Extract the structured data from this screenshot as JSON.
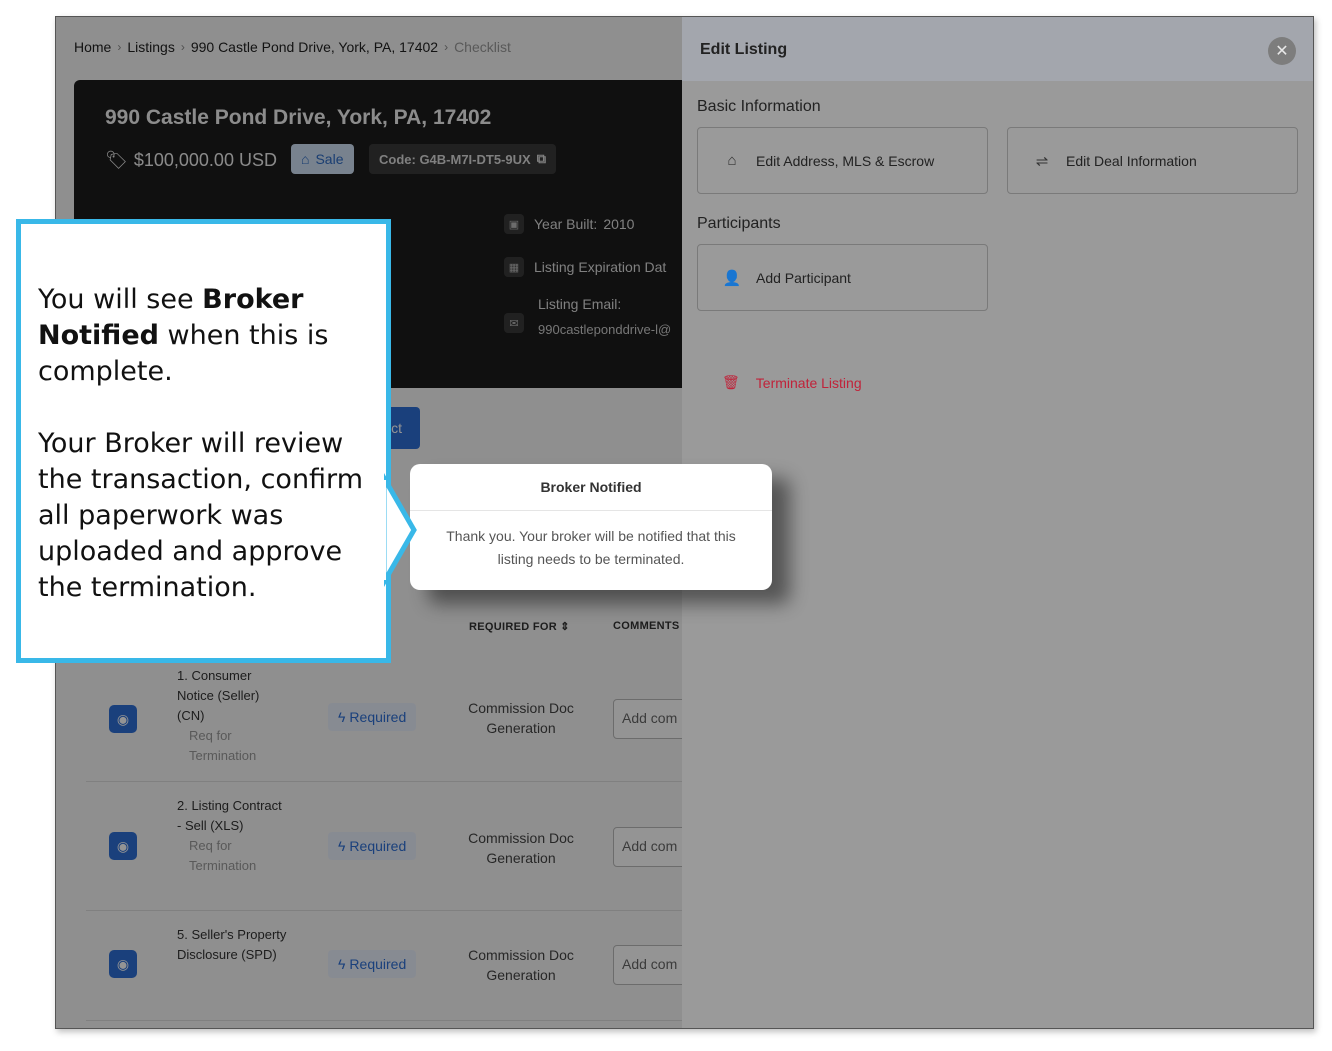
{
  "breadcrumb": {
    "home": "Home",
    "listings": "Listings",
    "address": "990 Castle Pond Drive, York, PA, 17402",
    "current": "Checklist"
  },
  "listing": {
    "address": "990 Castle Pond Drive, York, PA, 17402",
    "price": "$100,000.00 USD",
    "sale_label": "Sale",
    "code": "Code: G4B-M7I-DT5-9UX",
    "year_built_label": "Year Built:",
    "year_built": "2010",
    "expiration_label": "Listing Expiration Dat",
    "email_label": "Listing Email:",
    "email": "990castleponddrive-l@",
    "action_label": "ct"
  },
  "table": {
    "headers": {
      "required_for": "REQUIRED FOR",
      "comments": "COMMENTS"
    },
    "rows": [
      {
        "name": "1. Consumer Notice (Seller) (CN)",
        "tag": "Req for Termination",
        "status": "Required",
        "required_for": "Commission Doc Generation",
        "comment_placeholder": "Add com"
      },
      {
        "name": "2. Listing Contract - Sell (XLS)",
        "tag": "Req for Termination",
        "status": "Required",
        "required_for": "Commission Doc Generation",
        "comment_placeholder": "Add com"
      },
      {
        "name": "5. Seller's Property Disclosure (SPD)",
        "tag": "",
        "status": "Required",
        "required_for": "Commission Doc Generation",
        "comment_placeholder": "Add com"
      }
    ]
  },
  "drawer": {
    "title": "Edit Listing",
    "basic_info": "Basic Information",
    "edit_address": "Edit Address, MLS & Escrow",
    "edit_deal": "Edit Deal Information",
    "participants": "Participants",
    "add_participant": "Add Participant",
    "terminate": "Terminate Listing"
  },
  "modal": {
    "title": "Broker Notified",
    "body": "Thank you. Your broker will be notified that this listing needs to be terminated."
  },
  "callout": {
    "line1_pre": "You will see ",
    "line1_bold": "Broker Notified",
    "line1_post": " when this is complete.",
    "line2": "Your Broker will review the transaction, confirm all paperwork was uploaded and approve the termination."
  },
  "colors": {
    "callout_border": "#39b8e8",
    "primary_blue": "#2e6fd6",
    "terminate_red": "#c0233a"
  }
}
